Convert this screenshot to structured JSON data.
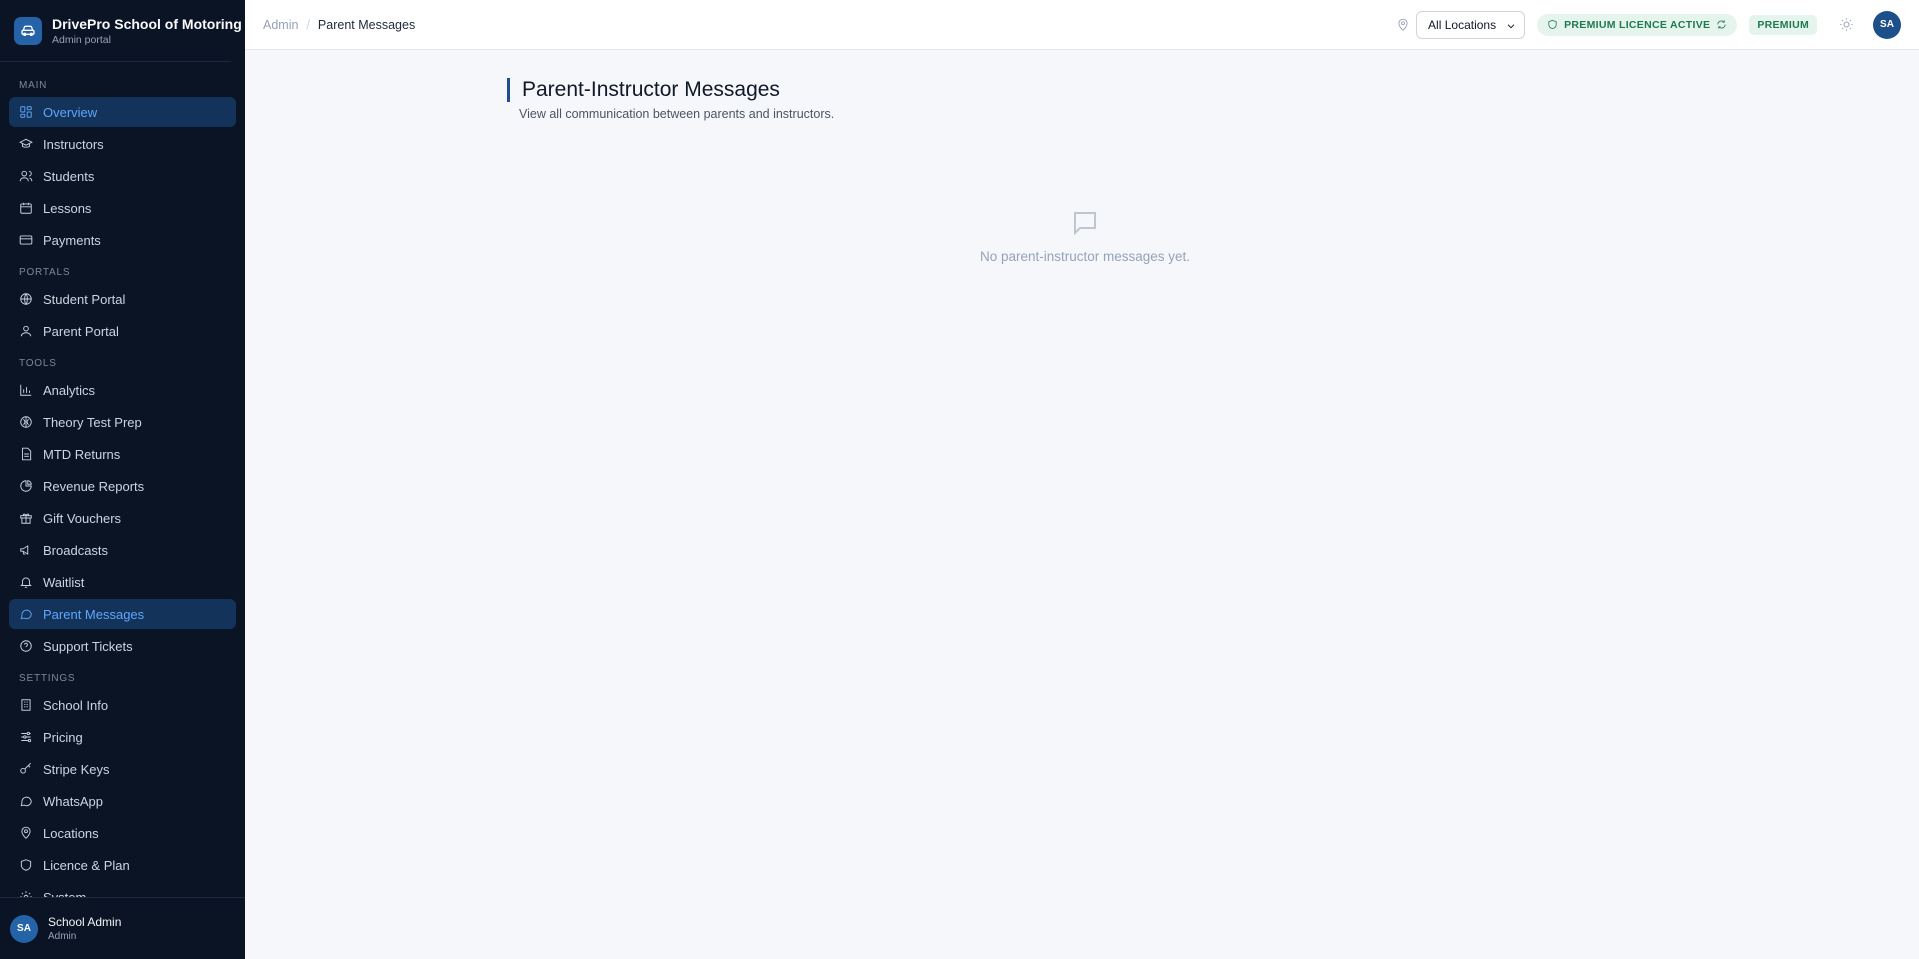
{
  "brand": {
    "name": "DrivePro School of Motoring",
    "subtitle": "Admin portal"
  },
  "sidebar": {
    "sections": {
      "main": "MAIN",
      "portals": "PORTALS",
      "tools": "TOOLS",
      "settings": "SETTINGS"
    },
    "main_items": [
      {
        "label": "Overview",
        "icon": "grid-icon"
      },
      {
        "label": "Instructors",
        "icon": "graduation-cap-icon"
      },
      {
        "label": "Students",
        "icon": "users-icon"
      },
      {
        "label": "Lessons",
        "icon": "calendar-icon"
      },
      {
        "label": "Payments",
        "icon": "credit-card-icon"
      }
    ],
    "portal_items": [
      {
        "label": "Student Portal",
        "icon": "globe-icon"
      },
      {
        "label": "Parent Portal",
        "icon": "user-icon"
      }
    ],
    "tool_items": [
      {
        "label": "Analytics",
        "icon": "bar-chart-icon"
      },
      {
        "label": "Theory Test Prep",
        "icon": "brain-icon"
      },
      {
        "label": "MTD Returns",
        "icon": "file-icon"
      },
      {
        "label": "Revenue Reports",
        "icon": "pie-chart-icon"
      },
      {
        "label": "Gift Vouchers",
        "icon": "gift-icon"
      },
      {
        "label": "Broadcasts",
        "icon": "megaphone-icon"
      },
      {
        "label": "Waitlist",
        "icon": "alarm-icon"
      },
      {
        "label": "Parent Messages",
        "icon": "message-icon"
      },
      {
        "label": "Support Tickets",
        "icon": "help-circle-icon"
      }
    ],
    "setting_items": [
      {
        "label": "School Info",
        "icon": "building-icon"
      },
      {
        "label": "Pricing",
        "icon": "sliders-icon"
      },
      {
        "label": "Stripe Keys",
        "icon": "key-icon"
      },
      {
        "label": "WhatsApp",
        "icon": "chat-icon"
      },
      {
        "label": "Locations",
        "icon": "map-pin-icon"
      },
      {
        "label": "Licence & Plan",
        "icon": "shield-icon"
      },
      {
        "label": "System",
        "icon": "settings-icon"
      }
    ],
    "footer": {
      "initials": "SA",
      "name": "School Admin",
      "role": "Admin"
    }
  },
  "topbar": {
    "breadcrumb_root": "Admin",
    "breadcrumb_sep": "/",
    "breadcrumb_current": "Parent Messages",
    "location_select": "All Locations",
    "licence_badge": "PREMIUM LICENCE ACTIVE",
    "plan_badge": "PREMIUM",
    "avatar_initials": "SA"
  },
  "main": {
    "title": "Parent-Instructor Messages",
    "subtitle": "View all communication between parents and instructors.",
    "empty_text": "No parent-instructor messages yet."
  },
  "colors": {
    "sidebar_bg": "#0b1424",
    "active_bg": "#14335a",
    "accent": "#2563a8",
    "badge_bg": "#e6f4ee",
    "badge_text": "#1f7a52"
  }
}
